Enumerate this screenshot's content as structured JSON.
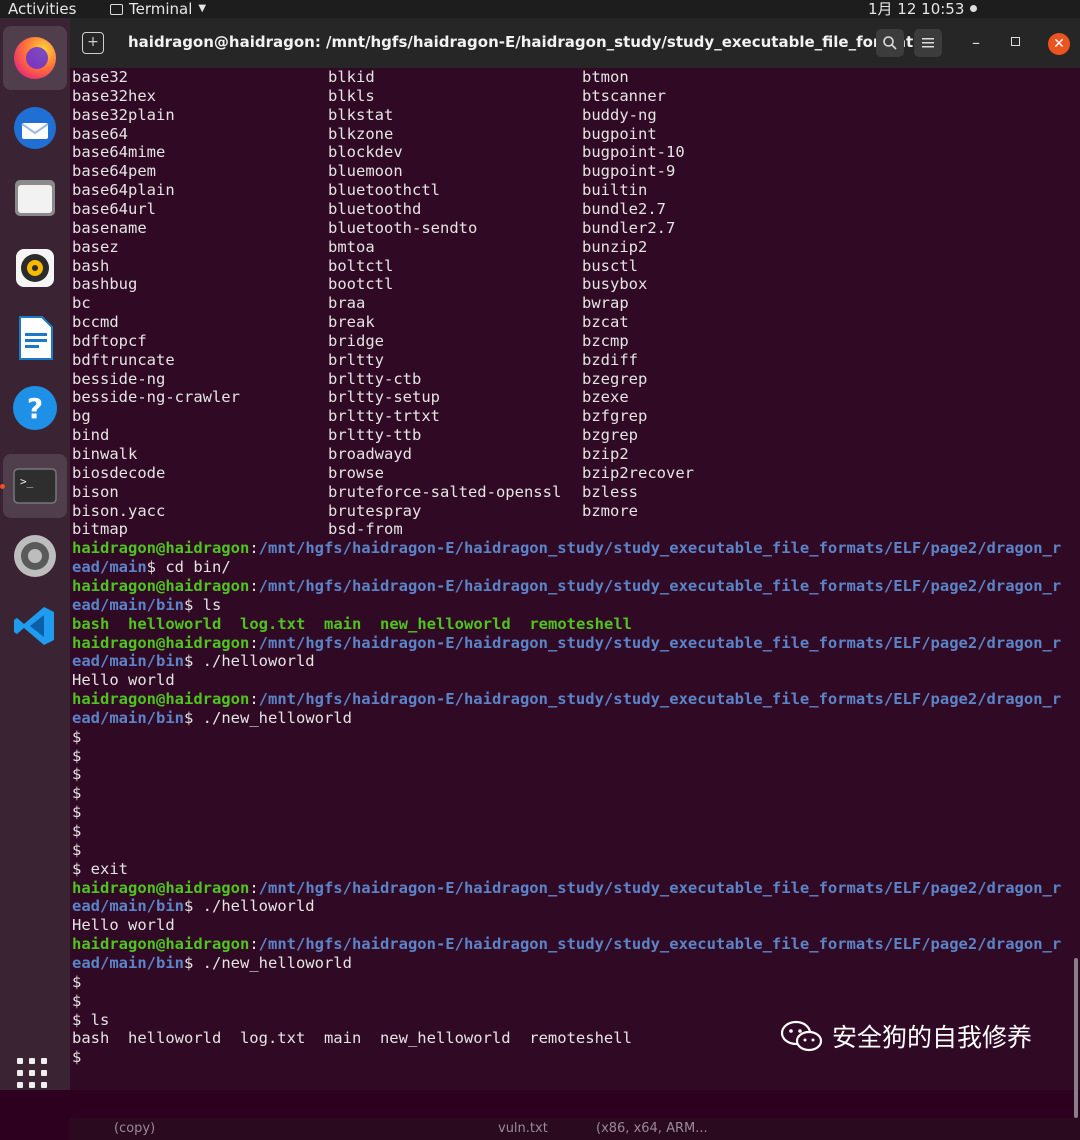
{
  "topbar": {
    "activities": "Activities",
    "app_name": "Terminal",
    "clock": "1月 12  10:53"
  },
  "window": {
    "title": "haidragon@haidragon: /mnt/hgfs/haidragon-E/haidragon_study/study_executable_file_formats..."
  },
  "dock": {
    "items": [
      "firefox-icon",
      "thunderbird-icon",
      "files-icon",
      "rhythmbox-icon",
      "libreoffice-writer-icon",
      "help-icon",
      "terminal-icon",
      "settings-icon",
      "vscode-icon"
    ]
  },
  "listing": [
    [
      "base32",
      "blkid",
      "btmon"
    ],
    [
      "base32hex",
      "blkls",
      "btscanner"
    ],
    [
      "base32plain",
      "blkstat",
      "buddy-ng"
    ],
    [
      "base64",
      "blkzone",
      "bugpoint"
    ],
    [
      "base64mime",
      "blockdev",
      "bugpoint-10"
    ],
    [
      "base64pem",
      "bluemoon",
      "bugpoint-9"
    ],
    [
      "base64plain",
      "bluetoothctl",
      "builtin"
    ],
    [
      "base64url",
      "bluetoothd",
      "bundle2.7"
    ],
    [
      "basename",
      "bluetooth-sendto",
      "bundler2.7"
    ],
    [
      "basez",
      "bmtoa",
      "bunzip2"
    ],
    [
      "bash",
      "boltctl",
      "busctl"
    ],
    [
      "bashbug",
      "bootctl",
      "busybox"
    ],
    [
      "bc",
      "braa",
      "bwrap"
    ],
    [
      "bccmd",
      "break",
      "bzcat"
    ],
    [
      "bdftopcf",
      "bridge",
      "bzcmp"
    ],
    [
      "bdftruncate",
      "brltty",
      "bzdiff"
    ],
    [
      "besside-ng",
      "brltty-ctb",
      "bzegrep"
    ],
    [
      "besside-ng-crawler",
      "brltty-setup",
      "bzexe"
    ],
    [
      "bg",
      "brltty-trtxt",
      "bzfgrep"
    ],
    [
      "bind",
      "brltty-ttb",
      "bzgrep"
    ],
    [
      "binwalk",
      "broadwayd",
      "bzip2"
    ],
    [
      "biosdecode",
      "browse",
      "bzip2recover"
    ],
    [
      "bison",
      "bruteforce-salted-openssl",
      "bzless"
    ],
    [
      "bison.yacc",
      "brutespray",
      "bzmore"
    ],
    [
      "bitmap",
      "bsd-from",
      ""
    ]
  ],
  "prompt": {
    "user": "haidragon@haidragon",
    "path_main": "/mnt/hgfs/haidragon-E/haidragon_study/study_executable_file_formats/ELF/page2/dragon_r",
    "path_main_wrap": "ead/main",
    "path_bin_wrap": "ead/main/bin"
  },
  "session": {
    "cmd_cd": " cd bin/",
    "cmd_ls": " ls",
    "ls_output": [
      "bash",
      "helloworld",
      "log.txt",
      "main",
      "new_helloworld",
      "remoteshell"
    ],
    "cmd_hello": " ./helloworld",
    "hello_output": "Hello world",
    "cmd_newhello": " ./new_helloworld",
    "dollar": "$",
    "exit_line": "$ exit",
    "ls_line": "$ ls",
    "final_ls_output": "bash  helloworld  log.txt  main  new_helloworld  remoteshell"
  },
  "bottom_strip": {
    "left": "(copy)",
    "mid": "vuln.txt",
    "right": "(x86, x64, ARM..."
  },
  "watermark": {
    "text": "安全狗的自我修养"
  },
  "colors": {
    "user": "#4ec41e",
    "path": "#5b84c8",
    "accent": "#e95420",
    "background": "#300a24"
  }
}
